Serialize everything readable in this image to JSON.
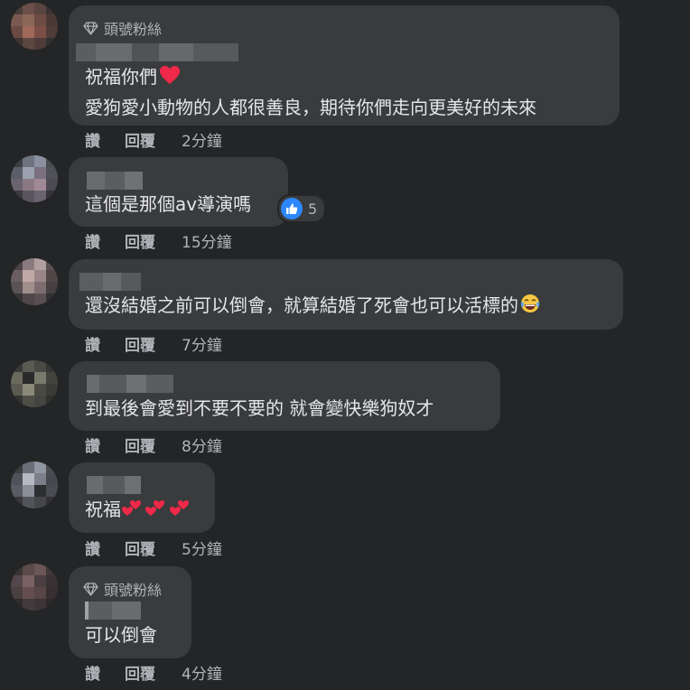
{
  "comments": [
    {
      "badge": "頭號粉絲",
      "text_lines": [
        "祝福你們",
        "愛狗愛小動物的人都很善良，期待你們走向更美好的未來"
      ],
      "actions": {
        "like": "讚",
        "reply": "回覆",
        "time": "2分鐘"
      }
    },
    {
      "text_lines": [
        "這個是那個av導演嗎"
      ],
      "reaction_count": "5",
      "actions": {
        "like": "讚",
        "reply": "回覆",
        "time": "15分鐘"
      }
    },
    {
      "text_lines": [
        "還沒結婚之前可以倒會，就算結婚了死會也可以活標的"
      ],
      "actions": {
        "like": "讚",
        "reply": "回覆",
        "time": "7分鐘"
      }
    },
    {
      "text_lines": [
        "到最後會愛到不要不要的 就會變快樂狗奴才"
      ],
      "actions": {
        "like": "讚",
        "reply": "回覆",
        "time": "8分鐘"
      }
    },
    {
      "text_lines": [
        "祝福"
      ],
      "actions": {
        "like": "讚",
        "reply": "回覆",
        "time": "5分鐘"
      }
    },
    {
      "badge": "頭號粉絲",
      "text_lines": [
        "可以倒會"
      ],
      "actions": {
        "like": "讚",
        "reply": "回覆",
        "time": "4分鐘"
      }
    }
  ],
  "icons": {
    "badge": "diamond-icon",
    "heart": "red-heart-icon",
    "like_reaction": "thumbs-up-icon",
    "laugh": "tears-of-joy-icon",
    "hearts": "two-hearts-icon"
  },
  "colors": {
    "background": "#242526",
    "bubble": "#3a3b3c",
    "text": "#e4e6eb",
    "muted": "#b0b3b8",
    "like_blue": "#2d88ff",
    "heart_red": "#f02849"
  }
}
